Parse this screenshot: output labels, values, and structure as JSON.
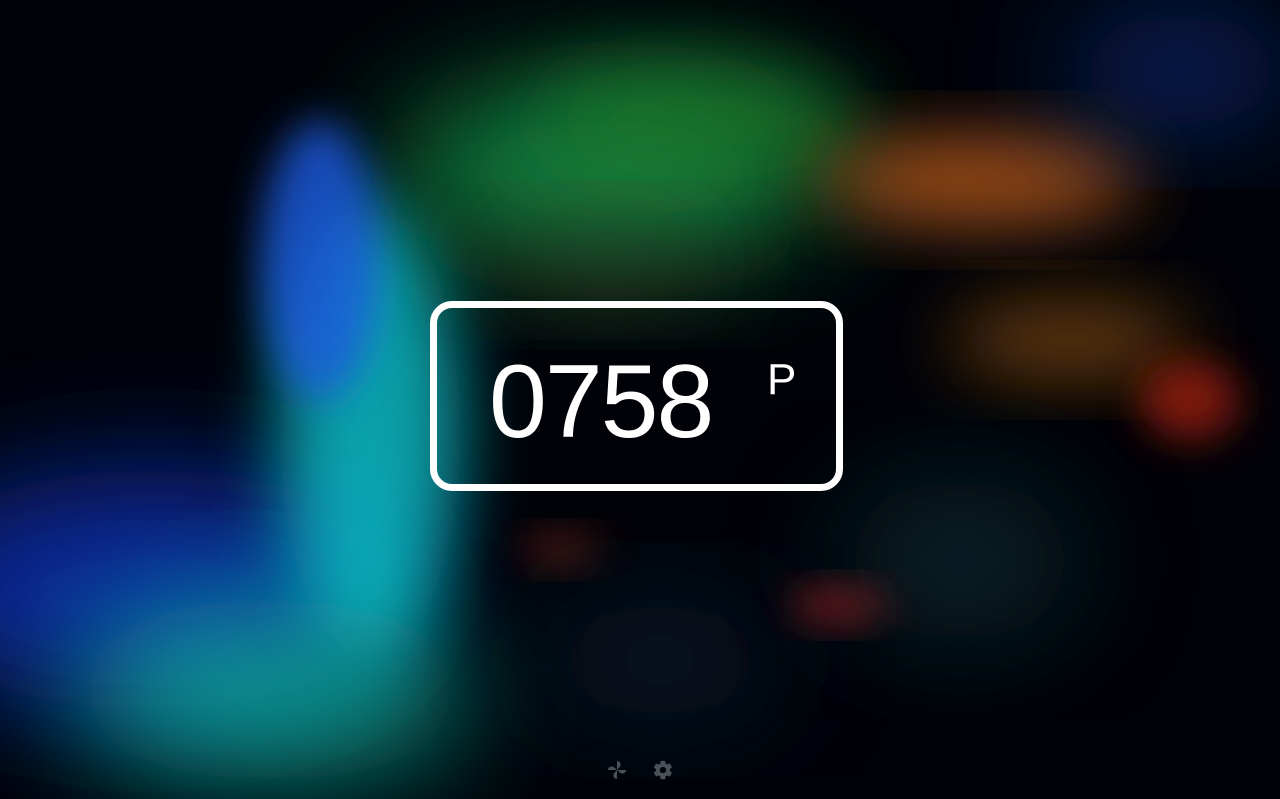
{
  "clock": {
    "time": "0758",
    "suffix": "P"
  },
  "controls": [
    {
      "icon": "pinwheel-icon",
      "label": ""
    },
    {
      "icon": "gear-icon",
      "label": ""
    }
  ],
  "colors": {
    "background": "#000000",
    "frame": "#ffffff",
    "text": "#ffffff",
    "icon": "#8a8f96"
  }
}
